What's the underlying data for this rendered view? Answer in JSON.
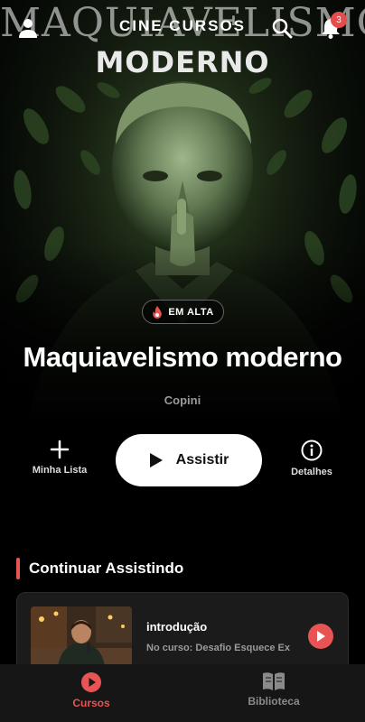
{
  "header": {
    "brand": "CINE CURSOS",
    "notification_count": "3"
  },
  "hero": {
    "poster_title_top": "MAQUIAVELISMO",
    "poster_title_bottom": "MODERNO",
    "trending_label": "EM ALTA",
    "title": "Maquiavelismo moderno",
    "author": "Copini"
  },
  "actions": {
    "my_list_label": "Minha Lista",
    "play_label": "Assistir",
    "details_label": "Detalhes"
  },
  "continue_watching": {
    "section_title": "Continuar Assistindo",
    "items": [
      {
        "title": "introdução",
        "subtitle": "No curso: Desafio Esquece Ex"
      }
    ]
  },
  "bottom_nav": {
    "items": [
      {
        "label": "Cursos",
        "active": true
      },
      {
        "label": "Biblioteca",
        "active": false
      }
    ]
  },
  "colors": {
    "accent": "#e85454",
    "background": "#000000",
    "card": "#1b1b1b",
    "nav_bg": "#161616"
  },
  "icons": [
    "user-icon",
    "search-icon",
    "bell-icon",
    "fire-icon",
    "plus-icon",
    "play-icon",
    "info-icon",
    "play-circle-icon",
    "book-icon"
  ]
}
